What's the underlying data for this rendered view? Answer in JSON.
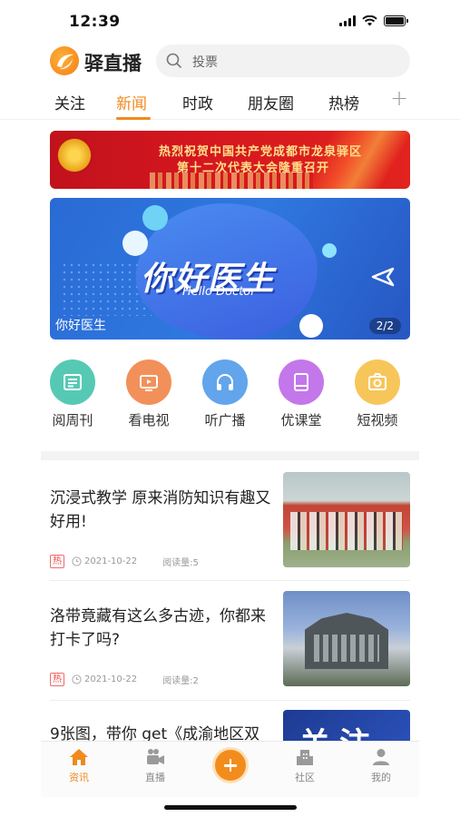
{
  "status_bar": {
    "time": "12:39"
  },
  "header": {
    "app_name": "驿直播",
    "search_placeholder": "投票"
  },
  "tabs": [
    {
      "label": "关注",
      "active": false
    },
    {
      "label": "新闻",
      "active": true
    },
    {
      "label": "时政",
      "active": false
    },
    {
      "label": "朋友圈",
      "active": false
    },
    {
      "label": "热榜",
      "active": false
    }
  ],
  "banner": {
    "line1": "热烈祝贺中国共产党成都市龙泉驿区",
    "line2": "第十二次代表大会隆重召开"
  },
  "hero": {
    "title": "你好医生",
    "subtitle": "Hello Doctor",
    "caption": "你好医生",
    "counter": "2/2"
  },
  "quick_links": [
    {
      "label": "阅周刊",
      "icon": "newspaper-icon",
      "color": "#56c9b4"
    },
    {
      "label": "看电视",
      "icon": "tv-icon",
      "color": "#f2905a"
    },
    {
      "label": "听广播",
      "icon": "headphones-icon",
      "color": "#62a5ec"
    },
    {
      "label": "优课堂",
      "icon": "book-icon",
      "color": "#c377ea"
    },
    {
      "label": "短视频",
      "icon": "camera-icon",
      "color": "#f7c65a"
    }
  ],
  "news": [
    {
      "title": "沉浸式教学 原来消防知识有趣又好用!",
      "tag": "热",
      "date": "2021-10-22",
      "reads": "阅读量:5"
    },
    {
      "title": "洛带竟藏有这么多古迹，你都来打卡了吗?",
      "tag": "热",
      "date": "2021-10-22",
      "reads": "阅读量:2"
    },
    {
      "title": "9张图，带你 get《成渝地区双城",
      "thumb_text": "关注"
    }
  ],
  "tabbar": [
    {
      "label": "资讯",
      "active": true
    },
    {
      "label": "直播",
      "active": false
    },
    {
      "label": "社区",
      "active": false
    },
    {
      "label": "我的",
      "active": false
    }
  ],
  "colors": {
    "accent": "#f08a1c",
    "hot_tag": "#ef4b4b"
  }
}
